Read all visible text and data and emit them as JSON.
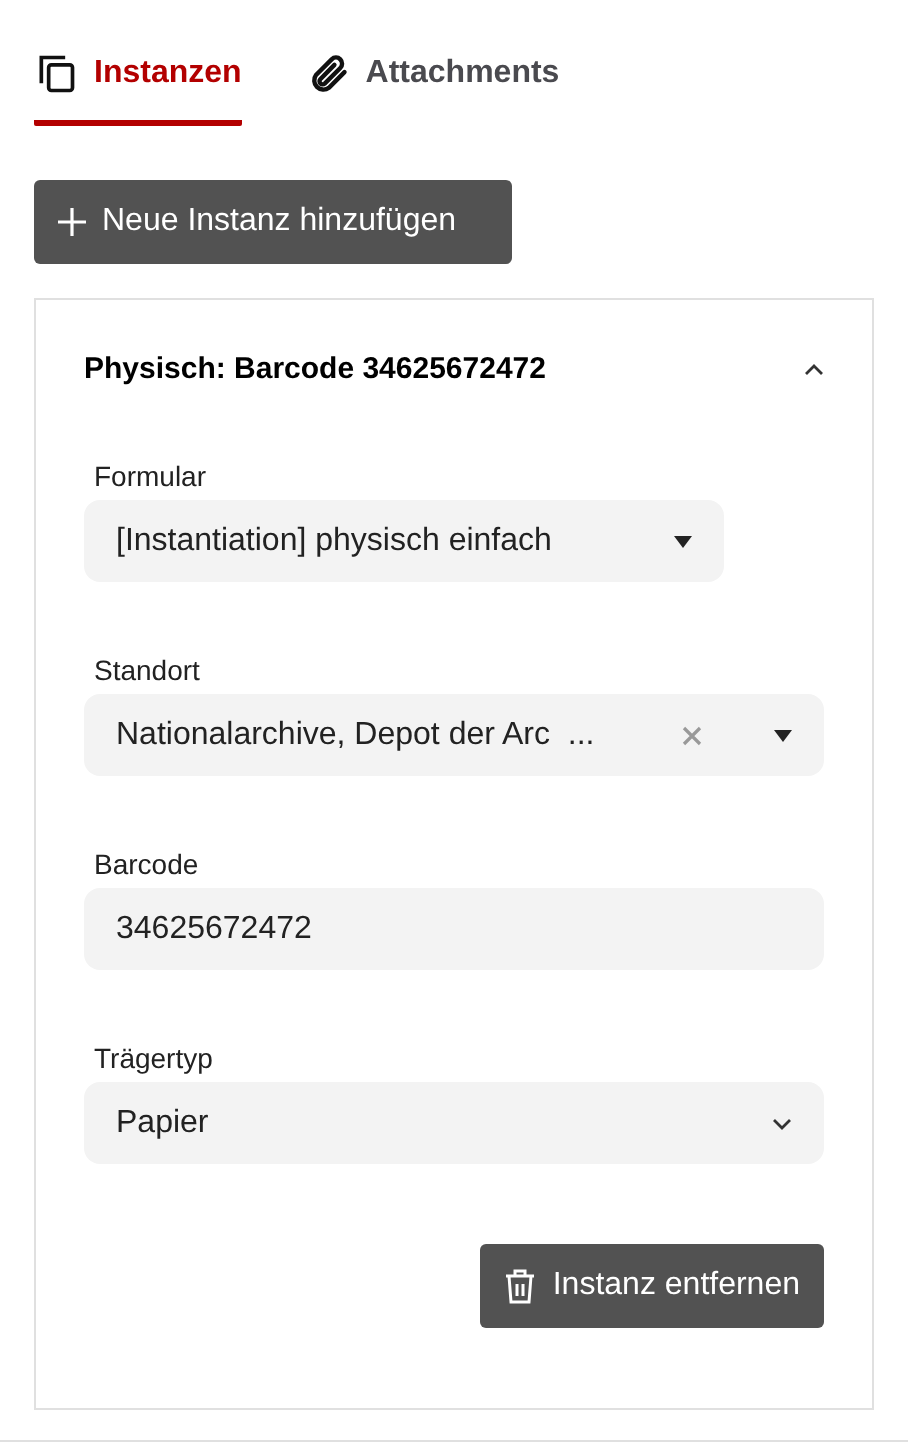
{
  "tabs": [
    {
      "label": "Instanzen",
      "kind": "instances",
      "selected": true
    },
    {
      "label": "Attachments",
      "kind": "attachments",
      "selected": false
    }
  ],
  "add_button": {
    "label": "Neue Instanz hinzufügen"
  },
  "instance": {
    "title": "Physisch: Barcode 34625672472",
    "expanded": true,
    "fields": [
      {
        "kind": "select",
        "label": "Formular",
        "value": "[Instantiation] physisch einfach",
        "compact": true,
        "clearable": false
      },
      {
        "kind": "select",
        "label": "Standort",
        "value": "Nationalarchive, Depot der Arc  ...",
        "compact": false,
        "clearable": true
      },
      {
        "kind": "input",
        "label": "Barcode",
        "value": "34625672472"
      },
      {
        "kind": "combobox",
        "label": "Trägertyp",
        "value": "Papier"
      }
    ],
    "remove_button": {
      "label": "Instanz entfernen"
    }
  }
}
